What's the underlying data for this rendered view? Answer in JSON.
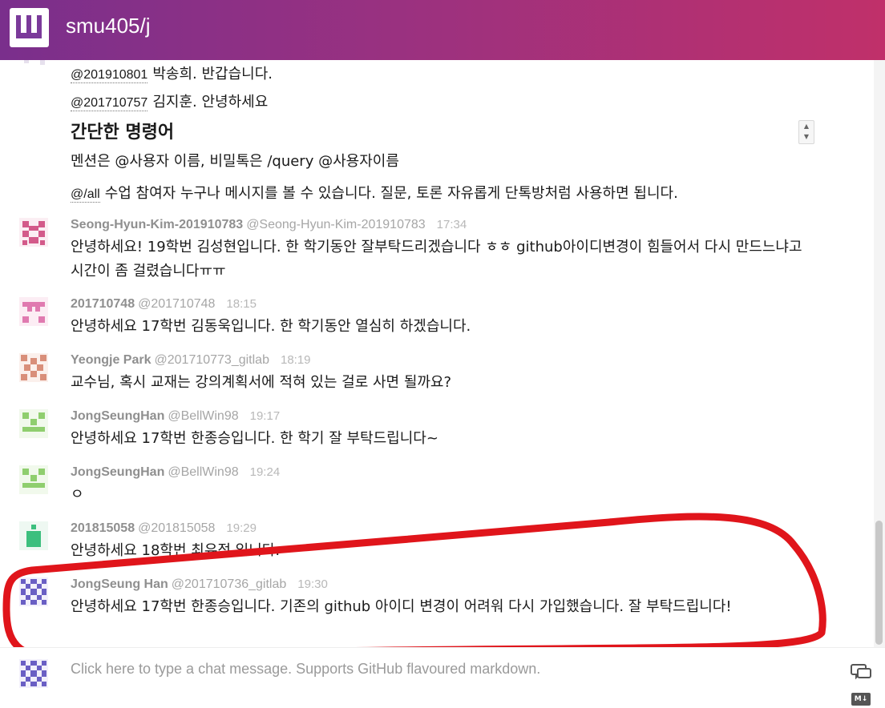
{
  "header": {
    "room_name": "smu405/j",
    "header_color_start": "#7a2f8c",
    "header_color_end": "#c0306a"
  },
  "intro": {
    "lines": [
      {
        "mention": "@201910801",
        "text": "박송희. 반갑습니다."
      },
      {
        "mention": "@201710757",
        "text": "김지훈. 안녕하세요"
      }
    ],
    "heading": "간단한 명령어",
    "commands_text": "멘션은 @사용자 이름, 비밀톡은 /query @사용자이름",
    "all_mention": "@/all",
    "all_text": "수업 참여자 누구나 메시지를 볼 수 있습니다. 질문, 토론 자유롭게 단톡방처럼 사용하면 됩니다."
  },
  "messages": [
    {
      "name": "Seong-Hyun-Kim-201910783",
      "username": "@Seong-Hyun-Kim-201910783",
      "time": "17:34",
      "text": "안녕하세요! 19학번 김성현입니다. 한 학기동안 잘부탁드리겠습니다 ㅎㅎ github아이디변경이 힘들어서 다시 만드느냐고 시간이 좀 걸렸습니다ㅠㅠ",
      "avatar_color": "#d35a8a"
    },
    {
      "name": "201710748",
      "username": "@201710748",
      "time": "18:15",
      "text": "안녕하세요 17학번 김동욱입니다. 한 학기동안 열심히 하겠습니다.",
      "avatar_color": "#e07ab0"
    },
    {
      "name": "Yeongje Park",
      "username": "@201710773_gitlab",
      "time": "18:19",
      "text": "교수님, 혹시 교재는 강의계획서에 적혀 있는 걸로 사면 될까요?",
      "avatar_color": "#d98f7a"
    },
    {
      "name": "JongSeungHan",
      "username": "@BellWin98",
      "time": "19:17",
      "text": "안녕하세요 17학번 한종승입니다. 한 학기 잘 부탁드립니다~",
      "avatar_color": "#8fce6e"
    },
    {
      "name": "JongSeungHan",
      "username": "@BellWin98",
      "time": "19:24",
      "text": "ㅇ",
      "avatar_color": "#8fce6e"
    },
    {
      "name": "201815058",
      "username": "@201815058",
      "time": "19:29",
      "text": "안녕하세요 18학번 최유정 입니다.",
      "avatar_color": "#3cbf7e"
    },
    {
      "name": "JongSeung Han",
      "username": "@201710736_gitlab",
      "time": "19:30",
      "text": "안녕하세요 17학번 한종승입니다. 기존의 github 아이디 변경이 어려워 다시 가입했습니다. 잘 부탁드립니다!",
      "avatar_color": "#6a5fc4"
    }
  ],
  "composer": {
    "placeholder": "Click here to type a chat message. Supports GitHub flavoured markdown.",
    "chat_icon": "chat-bubbles-icon",
    "markdown_icon": "markdown-icon",
    "markdown_label": "M↓"
  },
  "annotation_color": "#e0151b"
}
